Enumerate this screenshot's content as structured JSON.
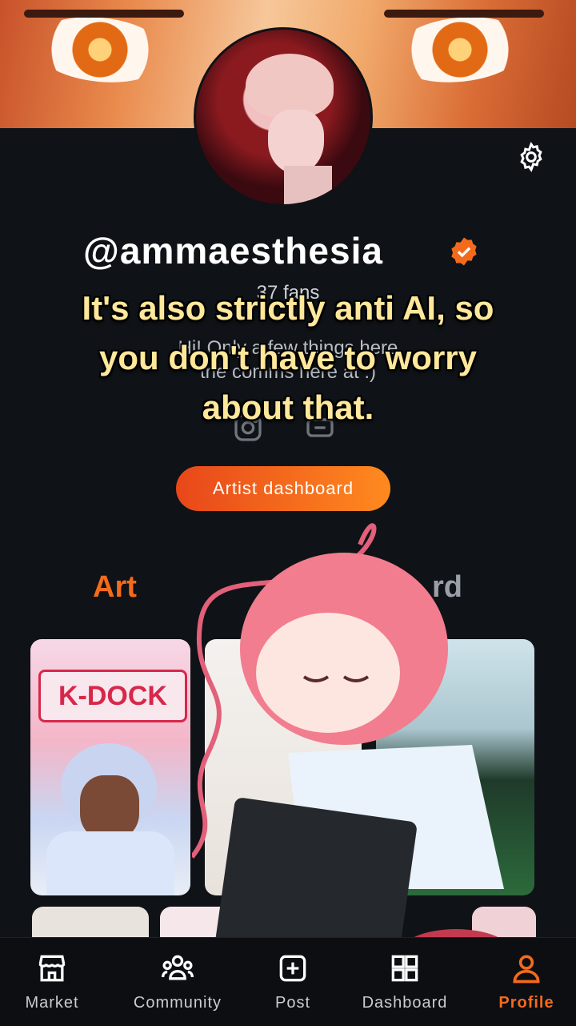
{
  "profile": {
    "username": "@ammaesthesia",
    "fans": "37 fans",
    "bio": "Hi! Only a few things here\nthe comms here at :)",
    "dashboard_button": "Artist dashboard"
  },
  "tabs": {
    "art": "Art",
    "other": "rd"
  },
  "caption": {
    "text": "It's also strictly anti AI, so you don't have to worry about that."
  },
  "gallery": {
    "tile1_sign": "K-DOCK"
  },
  "nav": {
    "items": [
      {
        "label": "Market",
        "icon": "store-icon"
      },
      {
        "label": "Community",
        "icon": "community-icon"
      },
      {
        "label": "Post",
        "icon": "post-icon"
      },
      {
        "label": "Dashboard",
        "icon": "dashboard-icon"
      },
      {
        "label": "Profile",
        "icon": "profile-icon"
      }
    ]
  },
  "colors": {
    "accent": "#f26b1d",
    "background": "#0f1216",
    "caption": "#ffe89b"
  }
}
